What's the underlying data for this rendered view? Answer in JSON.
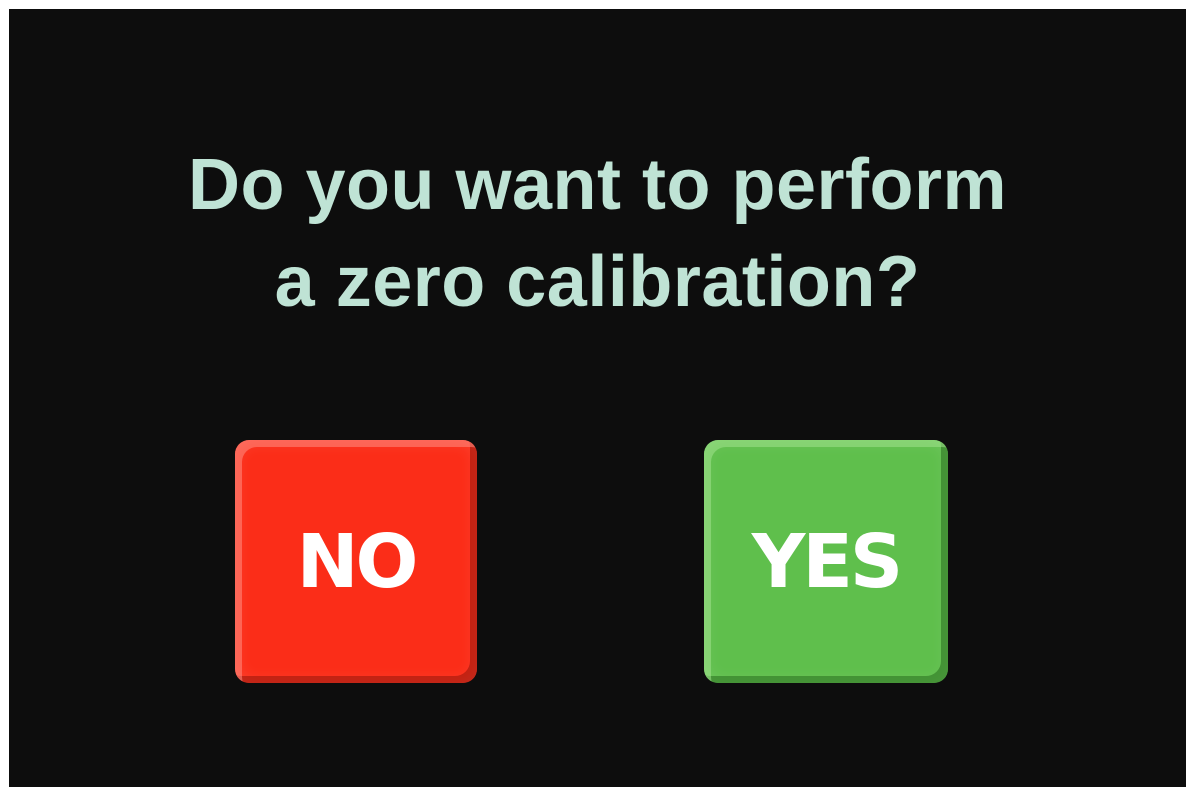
{
  "dialog": {
    "prompt_line1": "Do you want to perform",
    "prompt_line2": "a zero calibration?"
  },
  "buttons": {
    "no_label": "NO",
    "yes_label": "YES"
  },
  "colors": {
    "background": "#0d0d0d",
    "prompt_text": "#bfe3d5",
    "no_button": "#fb2d18",
    "yes_button": "#5fbf4c",
    "button_text": "#ffffff"
  }
}
